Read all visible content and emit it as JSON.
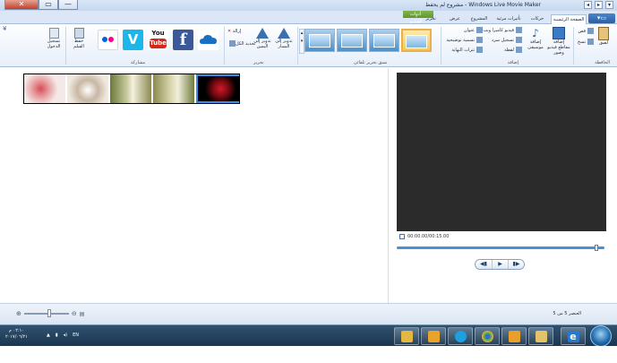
{
  "window": {
    "title": "Windows Live Movie Maker - مشروع لم يحفظ",
    "controls": {
      "close": "✕",
      "maximize": "▭",
      "minimize": "—"
    },
    "qat_items": [
      "◂",
      "▸",
      "▾"
    ]
  },
  "tabs": {
    "app_button": "▾▭",
    "context_label": "أدوات الفيديو",
    "items": [
      {
        "label": "الصفحة الرئيسية",
        "active": true
      },
      {
        "label": "حركات"
      },
      {
        "label": "تأثيرات مرئية"
      },
      {
        "label": "المشروع"
      },
      {
        "label": "عرض"
      },
      {
        "label": "تحرير"
      }
    ]
  },
  "ribbon": {
    "groups": {
      "clipboard": "الحافظة",
      "add": "إضافة",
      "themes": "نسق تحرير تلقائي",
      "editing": "تحرير",
      "sharing": "مشاركة"
    },
    "clipboard": {
      "paste": "لصق",
      "cut": "قص",
      "copy": "نسخ"
    },
    "add": {
      "add_media": "إضافة مقاطع فيديو وصور",
      "add_music": "إضافة موسيقى",
      "webcam": "فيديو كاميرا ويب",
      "narration": "تسجيل سرد",
      "snapshot": "لقطة",
      "title": "عنوان",
      "caption": "تسمية توضيحية",
      "credits": "تترات النهاية"
    },
    "editing": {
      "rotate_left": "تدوير إلى اليسار",
      "rotate_right": "تدوير إلى اليمين",
      "remove": "إزالة",
      "select_all": "تحديد الكل"
    },
    "sharing": {
      "onedrive": "OneDrive",
      "facebook": "f",
      "youtube_top": "You",
      "youtube_bottom": "Tube",
      "vimeo": "V",
      "flickr": "●●",
      "save_movie": "حفظ الفيلم",
      "sign_in": "تسجيل الدخول"
    },
    "theme_count": 4
  },
  "storyboard": {
    "clips": [
      "clip-1",
      "clip-2",
      "clip-3",
      "clip-4",
      "clip-5"
    ]
  },
  "preview": {
    "timecode": "00:00.00/00:15.00",
    "controls": {
      "prev": "◀▮",
      "play": "▶",
      "next": "▮▶"
    }
  },
  "statusbar": {
    "status": "العنصر 5 من 5",
    "zoom_out": "⊖",
    "zoom_in": "⊕"
  },
  "taskbar": {
    "time": "٠٢:١٠ م",
    "date": "٢٠١٧/٠٦/٢١",
    "lang": "EN",
    "tasks": [
      {
        "name": "explorer",
        "color": "#e2b844"
      },
      {
        "name": "media",
        "color": "#e8a32a"
      },
      {
        "name": "firefox",
        "color": "#e25f2a"
      },
      {
        "name": "chrome",
        "color": "#3aa84d"
      },
      {
        "name": "skype",
        "color": "#1ea0e0"
      },
      {
        "name": "tool",
        "color": "#c46a3a"
      },
      {
        "name": "folder",
        "color": "#8a6a4a"
      }
    ],
    "ie": "e"
  }
}
